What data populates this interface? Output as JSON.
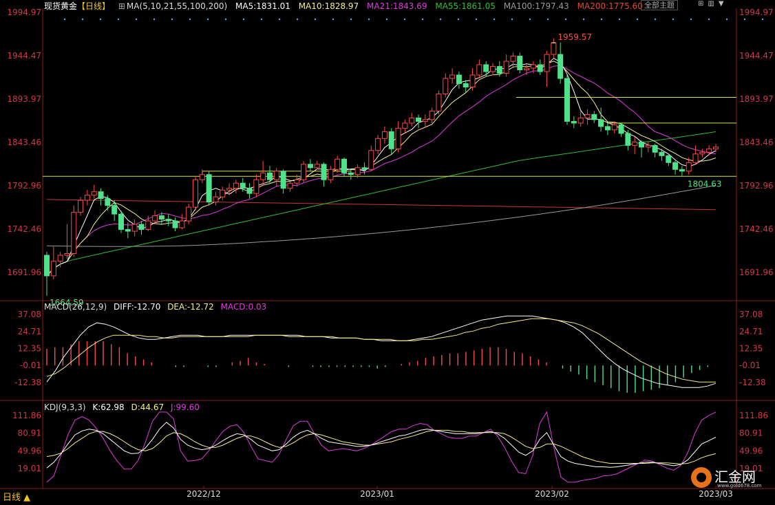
{
  "header": {
    "symbol": "现货黄金",
    "period_tag": "【日线】",
    "ma_params": "MA(5,10,21,55,100,200)",
    "ma5": "MA5:1831.01",
    "ma10": "MA10:1828.97",
    "ma21": "MA21:1843.69",
    "ma55": "MA55:1861.05",
    "ma100": "MA100:1797.43",
    "ma200": "MA200:1775.60",
    "theme_button": "全部主题"
  },
  "macd_header": {
    "name": "MACD(26,12,9)",
    "diff": "DIFF:-12.70",
    "dea": "DEA:-12.72",
    "macd": "MACD:0.03"
  },
  "kdj_header": {
    "name": "KDJ(9,3,3)",
    "k": "K:62.98",
    "d": "D:44.67",
    "j": "J:99.60"
  },
  "price_ticks": [
    "1994.97",
    "1944.47",
    "1893.97",
    "1843.46",
    "1792.96",
    "1742.46",
    "1691.96"
  ],
  "macd_ticks": [
    "37.08",
    "24.71",
    "12.35",
    "-0.01",
    "-12.38"
  ],
  "kdj_ticks": [
    "111.86",
    "80.91",
    "49.96",
    "19.01"
  ],
  "annotations": {
    "high": "1959.57",
    "low1": "1664.59",
    "low2": "1804.63"
  },
  "x_labels": [
    "2022/12",
    "2023/01",
    "2023/02",
    "2023/03"
  ],
  "footer": {
    "period": "日线 ▲"
  },
  "logo": {
    "name": "汇金网",
    "url": "www.gold678.com"
  },
  "colors": {
    "up": "#ff4a4a",
    "down": "#4ee28a",
    "ma5": "#ffffff",
    "ma10": "#f4f08a",
    "ma21": "#e03ae0",
    "ma55": "#2fbf2f",
    "ma100": "#9a9a9a",
    "ma200": "#c8382e",
    "axis_text": "#d0384a"
  },
  "chart_data": {
    "type": "candlestick",
    "price_range": [
      1650,
      2000
    ],
    "candles": [
      [
        1712,
        1688,
        1716,
        1664.59
      ],
      [
        1688,
        1705,
        1722,
        1684
      ],
      [
        1705,
        1712,
        1716,
        1698
      ],
      [
        1712,
        1714,
        1748,
        1708
      ],
      [
        1714,
        1762,
        1770,
        1710
      ],
      [
        1762,
        1776,
        1780,
        1758
      ],
      [
        1776,
        1782,
        1788,
        1770
      ],
      [
        1782,
        1786,
        1794,
        1778
      ],
      [
        1786,
        1778,
        1790,
        1770
      ],
      [
        1778,
        1770,
        1782,
        1764
      ],
      [
        1770,
        1760,
        1776,
        1752
      ],
      [
        1760,
        1742,
        1764,
        1738
      ],
      [
        1742,
        1740,
        1750,
        1732
      ],
      [
        1740,
        1748,
        1754,
        1734
      ],
      [
        1748,
        1742,
        1752,
        1736
      ],
      [
        1742,
        1752,
        1758,
        1740
      ],
      [
        1752,
        1758,
        1764,
        1748
      ],
      [
        1758,
        1754,
        1762,
        1748
      ],
      [
        1754,
        1752,
        1760,
        1746
      ],
      [
        1752,
        1744,
        1756,
        1740
      ],
      [
        1744,
        1752,
        1760,
        1742
      ],
      [
        1752,
        1768,
        1772,
        1748
      ],
      [
        1768,
        1800,
        1804,
        1764
      ],
      [
        1800,
        1806,
        1812,
        1796
      ],
      [
        1806,
        1774,
        1810,
        1770
      ],
      [
        1774,
        1780,
        1786,
        1770
      ],
      [
        1780,
        1788,
        1792,
        1776
      ],
      [
        1788,
        1790,
        1796,
        1782
      ],
      [
        1790,
        1796,
        1800,
        1784
      ],
      [
        1796,
        1790,
        1802,
        1786
      ],
      [
        1790,
        1784,
        1796,
        1778
      ],
      [
        1784,
        1800,
        1806,
        1780
      ],
      [
        1800,
        1808,
        1822,
        1794
      ],
      [
        1808,
        1800,
        1816,
        1796
      ],
      [
        1800,
        1810,
        1814,
        1792
      ],
      [
        1810,
        1790,
        1812,
        1784
      ],
      [
        1790,
        1796,
        1800,
        1786
      ],
      [
        1796,
        1800,
        1806,
        1792
      ],
      [
        1800,
        1818,
        1822,
        1796
      ],
      [
        1818,
        1814,
        1824,
        1810
      ],
      [
        1814,
        1818,
        1822,
        1812
      ],
      [
        1818,
        1800,
        1820,
        1792
      ],
      [
        1800,
        1812,
        1816,
        1796
      ],
      [
        1812,
        1824,
        1828,
        1808
      ],
      [
        1824,
        1808,
        1826,
        1804
      ],
      [
        1808,
        1806,
        1812,
        1800
      ],
      [
        1806,
        1814,
        1818,
        1802
      ],
      [
        1814,
        1812,
        1820,
        1806
      ],
      [
        1812,
        1834,
        1840,
        1810
      ],
      [
        1834,
        1848,
        1852,
        1830
      ],
      [
        1848,
        1856,
        1862,
        1842
      ],
      [
        1856,
        1836,
        1860,
        1830
      ],
      [
        1836,
        1860,
        1868,
        1832
      ],
      [
        1860,
        1866,
        1870,
        1854
      ],
      [
        1866,
        1872,
        1878,
        1862
      ],
      [
        1872,
        1868,
        1876,
        1860
      ],
      [
        1868,
        1870,
        1876,
        1862
      ],
      [
        1870,
        1880,
        1884,
        1866
      ],
      [
        1880,
        1900,
        1904,
        1876
      ],
      [
        1900,
        1918,
        1924,
        1896
      ],
      [
        1918,
        1922,
        1930,
        1912
      ],
      [
        1922,
        1912,
        1926,
        1906
      ],
      [
        1912,
        1908,
        1916,
        1902
      ],
      [
        1908,
        1922,
        1930,
        1904
      ],
      [
        1922,
        1934,
        1940,
        1918
      ],
      [
        1934,
        1926,
        1938,
        1920
      ],
      [
        1926,
        1932,
        1936,
        1922
      ],
      [
        1932,
        1924,
        1938,
        1920
      ],
      [
        1924,
        1938,
        1946,
        1920
      ],
      [
        1938,
        1944,
        1948,
        1930
      ],
      [
        1944,
        1928,
        1948,
        1924
      ],
      [
        1928,
        1930,
        1934,
        1922
      ],
      [
        1930,
        1934,
        1938,
        1924
      ],
      [
        1934,
        1926,
        1940,
        1922
      ],
      [
        1926,
        1946,
        1950,
        1908
      ],
      [
        1946,
        1959.57,
        1965,
        1942
      ],
      [
        1946,
        1918,
        1960,
        1912
      ],
      [
        1918,
        1868,
        1922,
        1864
      ],
      [
        1868,
        1866,
        1874,
        1860
      ],
      [
        1866,
        1872,
        1880,
        1862
      ],
      [
        1872,
        1876,
        1882,
        1864
      ],
      [
        1876,
        1870,
        1880,
        1866
      ],
      [
        1870,
        1862,
        1884,
        1856
      ],
      [
        1862,
        1858,
        1866,
        1852
      ],
      [
        1858,
        1864,
        1868,
        1854
      ],
      [
        1864,
        1854,
        1866,
        1850
      ],
      [
        1854,
        1840,
        1858,
        1834
      ],
      [
        1840,
        1844,
        1850,
        1830
      ],
      [
        1844,
        1838,
        1846,
        1826
      ],
      [
        1838,
        1840,
        1844,
        1832
      ],
      [
        1840,
        1832,
        1842,
        1826
      ],
      [
        1832,
        1828,
        1836,
        1822
      ],
      [
        1828,
        1820,
        1830,
        1816
      ],
      [
        1820,
        1812,
        1822,
        1806
      ],
      [
        1812,
        1810,
        1816,
        1804.63
      ],
      [
        1810,
        1820,
        1826,
        1806
      ],
      [
        1820,
        1830,
        1840,
        1818
      ],
      [
        1830,
        1832,
        1836,
        1826
      ],
      [
        1832,
        1836,
        1840,
        1828
      ],
      [
        1836,
        1838,
        1842,
        1832
      ]
    ],
    "horizontal_levels": [
      1896,
      1866,
      1804
    ],
    "macd": {
      "diff": [
        -12,
        -4,
        6,
        14,
        22,
        28,
        31,
        30,
        28,
        25,
        22,
        20,
        19,
        19,
        20,
        21,
        22,
        22,
        22,
        21,
        21,
        21,
        22,
        22,
        22,
        22,
        22,
        22,
        22,
        22,
        22,
        21,
        21,
        21,
        20,
        20,
        20,
        20,
        19,
        19,
        18,
        18,
        18,
        18,
        19,
        20,
        21,
        23,
        25,
        27,
        29,
        31,
        33,
        34,
        35,
        36,
        36,
        36,
        36,
        35,
        34,
        33,
        31,
        28,
        24,
        18,
        12,
        6,
        1,
        -3,
        -6,
        -9,
        -11,
        -13,
        -14,
        -15,
        -16,
        -16,
        -16,
        -15,
        -13
      ],
      "dea": [
        -8,
        -6,
        -2,
        3,
        8,
        13,
        17,
        20,
        22,
        22,
        22,
        22,
        21,
        21,
        20,
        20,
        21,
        21,
        21,
        21,
        21,
        21,
        21,
        21,
        21,
        22,
        22,
        22,
        22,
        21,
        21,
        21,
        21,
        21,
        21,
        20,
        20,
        20,
        19,
        19,
        19,
        19,
        18,
        18,
        18,
        19,
        19,
        20,
        21,
        22,
        24,
        25,
        27,
        28,
        30,
        31,
        32,
        33,
        34,
        34,
        34,
        33,
        32,
        31,
        29,
        26,
        23,
        19,
        15,
        11,
        7,
        3,
        0,
        -3,
        -6,
        -8,
        -10,
        -11,
        -12,
        -12,
        -12
      ],
      "hist": [
        11,
        12,
        12,
        14,
        16,
        16,
        16,
        16,
        14,
        12,
        8,
        6,
        4,
        2,
        0,
        0,
        -1,
        -1,
        0,
        0,
        -1,
        -1,
        0,
        2,
        3,
        5,
        2,
        1,
        0,
        0,
        -1,
        0,
        0,
        -1,
        -1,
        -1,
        -1,
        -1,
        -1,
        -1,
        -1,
        -2,
        -1,
        0,
        1,
        2,
        3,
        5,
        6,
        7,
        8,
        8,
        9,
        10,
        11,
        12,
        12,
        11,
        9,
        8,
        6,
        4,
        2,
        0,
        -2,
        -4,
        -6,
        -9,
        -11,
        -13,
        -15,
        -17,
        -18,
        -18,
        -17,
        -16,
        -15,
        -13,
        -11,
        -8,
        -5,
        -3,
        -1,
        0
      ]
    },
    "kdj": {
      "k": [
        20,
        30,
        45,
        62,
        78,
        85,
        88,
        86,
        80,
        70,
        60,
        50,
        45,
        46,
        55,
        70,
        88,
        100,
        90,
        70,
        60,
        55,
        52,
        54,
        60,
        68,
        75,
        80,
        78,
        70,
        60,
        55,
        50,
        52,
        62,
        74,
        82,
        86,
        80,
        72,
        66,
        64,
        62,
        60,
        58,
        58,
        60,
        64,
        68,
        72,
        76,
        78,
        82,
        86,
        88,
        86,
        84,
        82,
        80,
        80,
        80,
        80,
        82,
        84,
        80,
        72,
        60,
        48,
        42,
        50,
        70,
        82,
        60,
        40,
        32,
        28,
        26,
        24,
        22,
        22,
        21,
        22,
        24,
        26,
        28,
        30,
        30,
        28,
        26,
        24,
        26,
        34,
        48,
        62,
        68,
        74
      ],
      "d": [
        40,
        42,
        46,
        54,
        64,
        72,
        80,
        84,
        84,
        80,
        74,
        66,
        58,
        52,
        50,
        54,
        64,
        76,
        82,
        80,
        74,
        66,
        60,
        56,
        56,
        60,
        66,
        72,
        76,
        76,
        72,
        66,
        60,
        56,
        58,
        64,
        72,
        78,
        80,
        78,
        74,
        70,
        66,
        64,
        62,
        60,
        60,
        62,
        64,
        66,
        70,
        73,
        76,
        80,
        84,
        86,
        86,
        86,
        84,
        84,
        82,
        82,
        82,
        82,
        82,
        80,
        74,
        66,
        58,
        54,
        56,
        62,
        62,
        58,
        52,
        46,
        40,
        36,
        32,
        30,
        28,
        28,
        28,
        28,
        28,
        28,
        29,
        29,
        29,
        28,
        27,
        28,
        32,
        38,
        42,
        45
      ],
      "j": [
        -8,
        6,
        42,
        78,
        104,
        110,
        104,
        90,
        72,
        50,
        32,
        18,
        18,
        34,
        65,
        102,
        136,
        148,
        106,
        50,
        32,
        33,
        36,
        50,
        68,
        84,
        93,
        96,
        82,
        58,
        36,
        33,
        30,
        44,
        70,
        94,
        102,
        102,
        80,
        60,
        50,
        52,
        54,
        52,
        50,
        54,
        60,
        68,
        76,
        84,
        88,
        88,
        94,
        98,
        96,
        86,
        80,
        74,
        72,
        72,
        76,
        76,
        82,
        88,
        76,
        56,
        32,
        12,
        10,
        42,
        98,
        122,
        56,
        4,
        -8,
        -8,
        -2,
        0,
        2,
        6,
        7,
        10,
        16,
        22,
        28,
        34,
        32,
        26,
        20,
        16,
        24,
        46,
        80,
        104,
        112,
        118
      ]
    }
  }
}
